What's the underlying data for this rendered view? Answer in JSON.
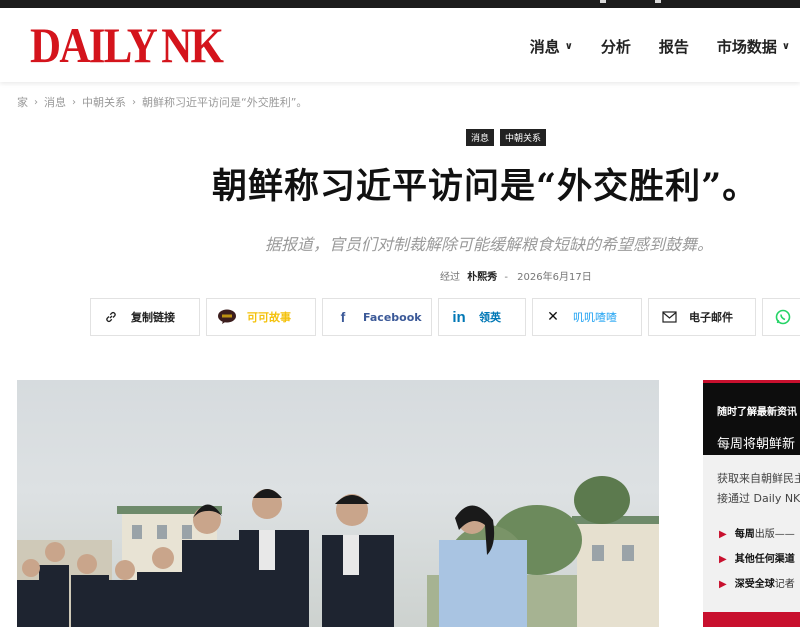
{
  "logo": {
    "daily": "DAILY",
    "nk": "NK"
  },
  "nav": [
    {
      "label": "消息",
      "dropdown": true
    },
    {
      "label": "分析",
      "dropdown": false
    },
    {
      "label": "报告",
      "dropdown": false
    },
    {
      "label": "市场数据",
      "dropdown": true
    }
  ],
  "breadcrumb": [
    "家",
    "消息",
    "中朝关系",
    "朝鲜称习近平访问是“外交胜利”。"
  ],
  "tags": [
    "消息",
    "中朝关系"
  ],
  "article": {
    "title": "朝鲜称习近平访问是“外交胜利”。",
    "subtitle": "据报道，官员们对制裁解除可能缓解粮食短缺的希望感到鼓舞。",
    "byline_prefix": "经过",
    "author": "朴熙秀",
    "byline_sep": "-",
    "date": "2026年6月17日"
  },
  "share_buttons": [
    {
      "label": "复制链接",
      "icon": "link-icon",
      "color": "#222222"
    },
    {
      "label": "可可故事",
      "icon": "kakaotalk-icon",
      "color": "#f4c20d"
    },
    {
      "label": "Facebook",
      "icon": "facebook-icon",
      "color": "#3b5998"
    },
    {
      "label": "领英",
      "icon": "linkedin-icon",
      "color": "#0077b5"
    },
    {
      "label": "叽叽喳喳",
      "icon": "x-icon",
      "color": "#1da1f2"
    },
    {
      "label": "电子邮件",
      "icon": "mail-icon",
      "color": "#222222"
    },
    {
      "label": "",
      "icon": "whatsapp-icon",
      "color": "#25d366"
    }
  ],
  "sidebar": {
    "heading": "随时了解最新资讯",
    "subheading": "每周将朝鲜新",
    "desc_line1": "获取来自朝鲜民主",
    "desc_line2": "接通过 Daily NK",
    "bullets": [
      {
        "bold": "每周",
        "rest": "出版——"
      },
      {
        "bold": "",
        "rest": "其他任何渠道"
      },
      {
        "bold": "深受全球",
        "rest": "记者"
      }
    ]
  },
  "colors": {
    "brand_red": "#d4141c",
    "accent_red": "#c8102e"
  }
}
